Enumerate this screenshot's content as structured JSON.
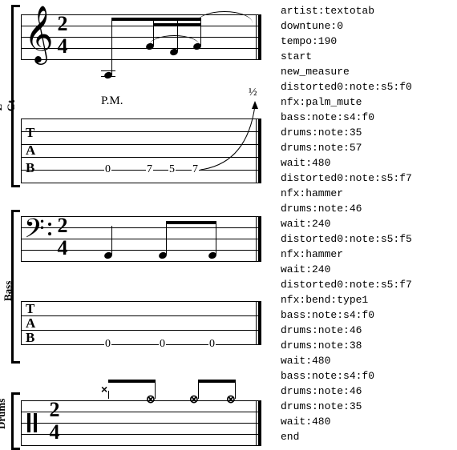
{
  "instruments": {
    "egt": {
      "label": "E-Gt",
      "time_sig_top": "2",
      "time_sig_bot": "4",
      "pm_text": "P.M.",
      "bend_text": "½",
      "tab_label_t": "T",
      "tab_label_a": "A",
      "tab_label_b": "B",
      "tab_frets": {
        "f1": "0",
        "f2": "7",
        "f3": "5",
        "f4": "7"
      }
    },
    "ebass": {
      "label": "E-Bass",
      "time_sig_top": "2",
      "time_sig_bot": "4",
      "tab_label_t": "T",
      "tab_label_a": "A",
      "tab_label_b": "B",
      "tab_frets": {
        "f1": "0",
        "f2": "0",
        "f3": "0"
      }
    },
    "drums": {
      "label": "Drums",
      "time_sig_top": "2",
      "time_sig_bot": "4"
    }
  },
  "commands": {
    "c0": "artist:textotab",
    "c1": "downtune:0",
    "c2": "tempo:190",
    "c3": "start",
    "c4": "new_measure",
    "c5": "distorted0:note:s5:f0",
    "c6": "nfx:palm_mute",
    "c7": "bass:note:s4:f0",
    "c8": "drums:note:35",
    "c9": "drums:note:57",
    "c10": "wait:480",
    "c11": "distorted0:note:s5:f7",
    "c12": "nfx:hammer",
    "c13": "drums:note:46",
    "c14": "wait:240",
    "c15": "distorted0:note:s5:f5",
    "c16": "nfx:hammer",
    "c17": "wait:240",
    "c18": "distorted0:note:s5:f7",
    "c19": "nfx:bend:type1",
    "c20": "bass:note:s4:f0",
    "c21": "drums:note:46",
    "c22": "drums:note:38",
    "c23": "wait:480",
    "c24": "bass:note:s4:f0",
    "c25": "drums:note:46",
    "c26": "drums:note:35",
    "c27": "wait:480",
    "c28": "end"
  }
}
